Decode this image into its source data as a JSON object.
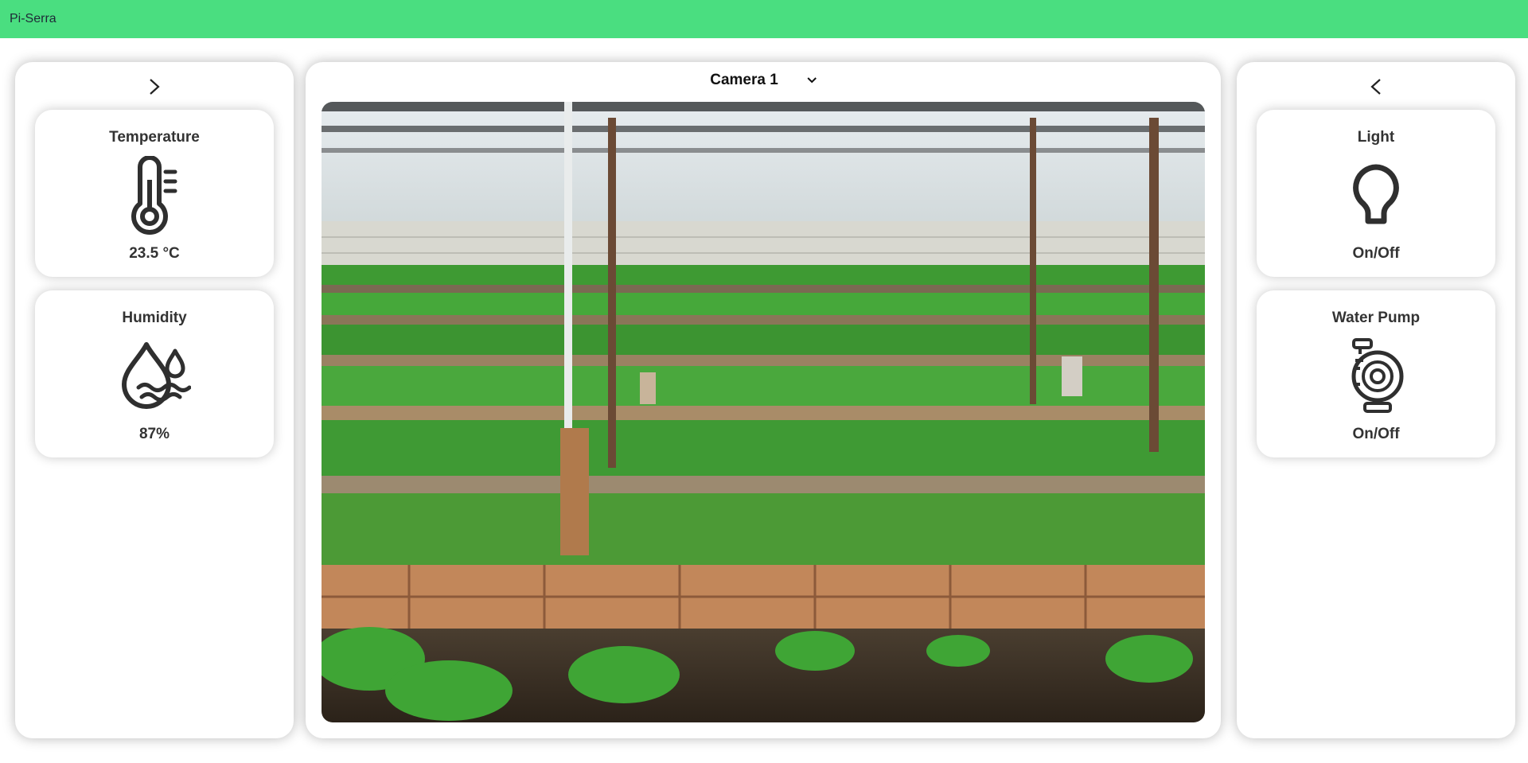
{
  "app": {
    "title": "Pi-Serra"
  },
  "left_panel": {
    "temperature": {
      "title": "Temperature",
      "value": "23.5 °C",
      "icon": "thermometer-icon"
    },
    "humidity": {
      "title": "Humidity",
      "value": "87%",
      "icon": "humidity-drops-icon"
    }
  },
  "center_panel": {
    "camera": {
      "selected": "Camera 1"
    }
  },
  "right_panel": {
    "light": {
      "title": "Light",
      "value": "On/Off",
      "icon": "light-bulb-icon"
    },
    "water_pump": {
      "title": "Water Pump",
      "value": "On/Off",
      "icon": "water-pump-icon"
    }
  },
  "colors": {
    "topbar": "#4ade80",
    "icon": "#2f2f2f"
  }
}
